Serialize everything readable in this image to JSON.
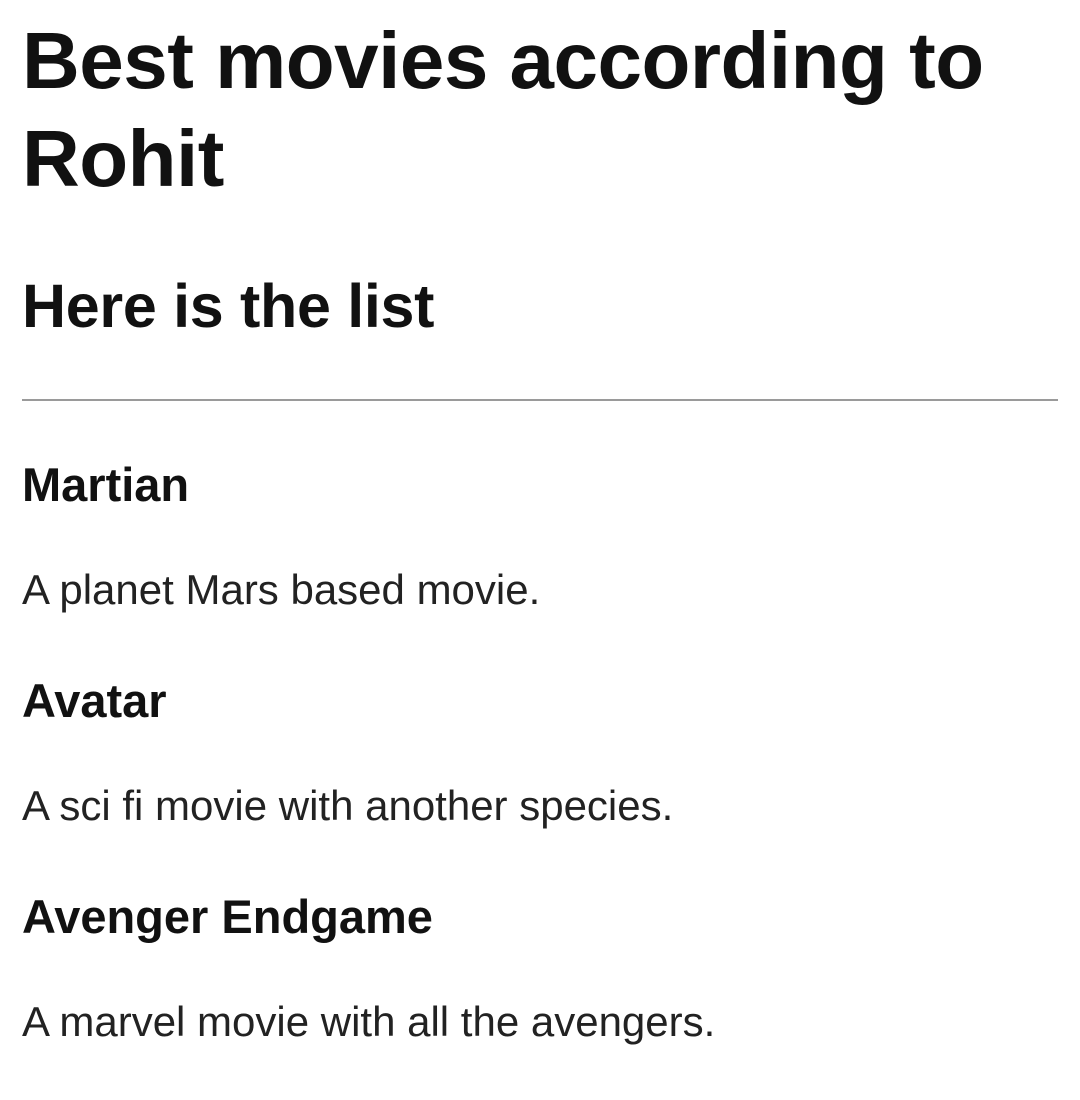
{
  "page": {
    "title": "Best movies according to Rohit",
    "subtitle": "Here is the list"
  },
  "movies": [
    {
      "name": "Martian",
      "description": "A planet Mars based movie."
    },
    {
      "name": "Avatar",
      "description": "A sci fi movie with another species."
    },
    {
      "name": "Avenger Endgame",
      "description": "A marvel movie with all the avengers."
    }
  ]
}
